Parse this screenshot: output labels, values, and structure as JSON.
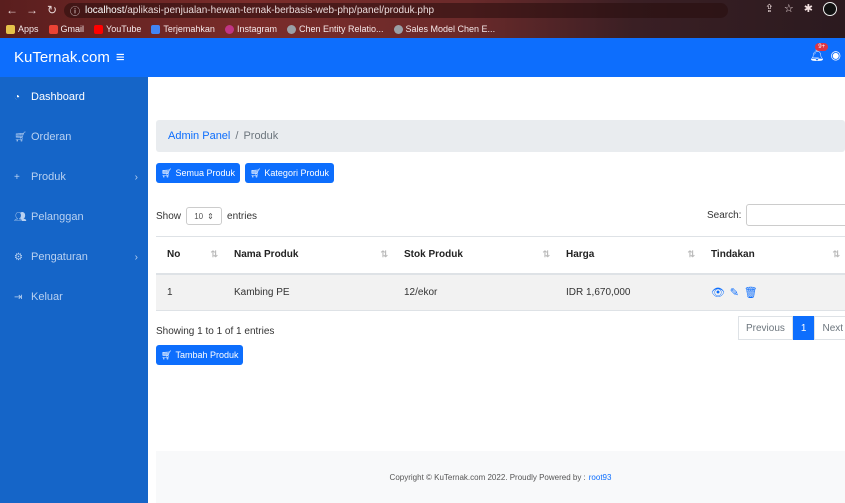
{
  "browser": {
    "url_host": "localhost",
    "url_path": "/aplikasi-penjualan-hewan-ternak-berbasis-web-php/panel/produk.php",
    "bookmarks": [
      "Apps",
      "Gmail",
      "YouTube",
      "Terjemahkan",
      "Instagram",
      "Chen Entity Relatio...",
      "Sales Model Chen E..."
    ]
  },
  "navbar": {
    "brand": "KuTernak.com",
    "notification_count": "9+"
  },
  "sidebar": {
    "items": [
      {
        "label": "Dashboard",
        "icon": "dashboard-icon",
        "active": true
      },
      {
        "label": "Orderan",
        "icon": "cart-icon"
      },
      {
        "label": "Produk",
        "icon": "plus-icon",
        "has_chevron": true
      },
      {
        "label": "Pelanggan",
        "icon": "users-icon"
      },
      {
        "label": "Pengaturan",
        "icon": "gear-icon",
        "has_chevron": true
      },
      {
        "label": "Keluar",
        "icon": "logout-icon"
      }
    ]
  },
  "breadcrumb": {
    "root": "Admin Panel",
    "sep": "/",
    "current": "Produk"
  },
  "buttons": {
    "all_products": "Semua Produk",
    "categories": "Kategori Produk",
    "add_product": "Tambah Produk"
  },
  "table_controls": {
    "show_label": "Show",
    "entries_value": "10",
    "entries_label": "entries",
    "search_label": "Search:"
  },
  "table": {
    "headers": [
      "No",
      "Nama Produk",
      "Stok Produk",
      "Harga",
      "Tindakan"
    ],
    "rows": [
      [
        "1",
        "Kambing PE",
        "12/ekor",
        "IDR 1,670,000"
      ]
    ]
  },
  "info": "Showing 1 to 1 of 1 entries",
  "pagination": {
    "prev": "Previous",
    "current": "1",
    "next": "Next"
  },
  "footer": {
    "text": "Copyright © KuTernak.com 2022. Proudly Powered by :",
    "link": "root93"
  },
  "colors": {
    "primary": "#0d6efd",
    "sidebar": "#1565c8"
  }
}
